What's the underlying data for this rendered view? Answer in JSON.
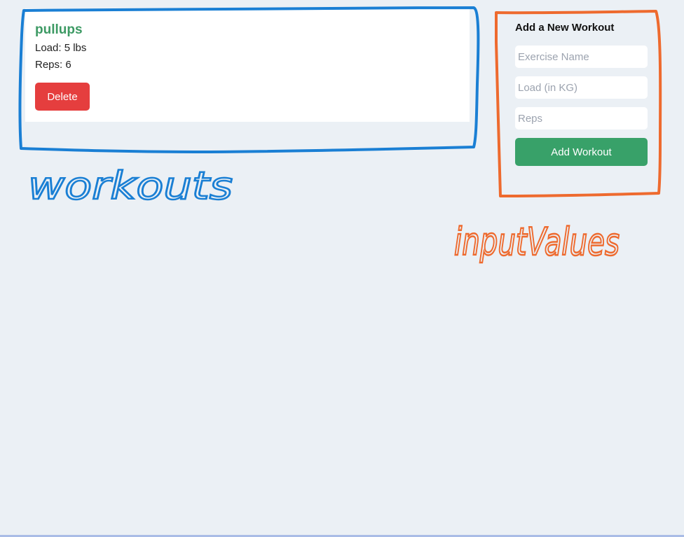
{
  "workouts": {
    "items": [
      {
        "name": "pullups",
        "load_text": "Load: 5 lbs",
        "reps_text": "Reps: 6",
        "delete_label": "Delete"
      }
    ]
  },
  "form": {
    "title": "Add a New Workout",
    "exercise_placeholder": "Exercise Name",
    "exercise_value": "",
    "load_placeholder": "Load (in KG)",
    "load_value": "",
    "reps_placeholder": "Reps",
    "reps_value": "",
    "submit_label": "Add Workout"
  },
  "annotations": {
    "workouts_label": "workouts",
    "inputs_label": "inputValues",
    "workouts_color": "#1a7fd4",
    "inputs_color": "#ee6a2e"
  },
  "colors": {
    "background": "#ebf0f5",
    "title_green": "#3d9a64",
    "delete_red": "#e53e3e",
    "add_green": "#38a169"
  }
}
